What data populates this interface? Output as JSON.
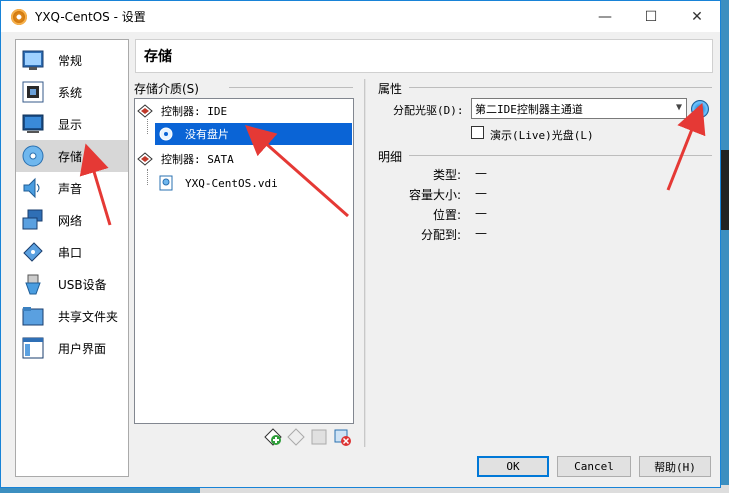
{
  "window": {
    "title": "YXQ-CentOS - 设置",
    "minimize": "—",
    "maximize": "☐",
    "close": "✕"
  },
  "sidebar": {
    "items": [
      {
        "label": "常规",
        "icon": "general-icon"
      },
      {
        "label": "系统",
        "icon": "system-chip-icon"
      },
      {
        "label": "显示",
        "icon": "display-monitor-icon"
      },
      {
        "label": "存储",
        "icon": "storage-disk-icon",
        "active": true
      },
      {
        "label": "声音",
        "icon": "speaker-icon"
      },
      {
        "label": "网络",
        "icon": "network-icon"
      },
      {
        "label": "串口",
        "icon": "serial-port-icon"
      },
      {
        "label": "USB设备",
        "icon": "usb-icon"
      },
      {
        "label": "共享文件夹",
        "icon": "folder-icon"
      },
      {
        "label": "用户界面",
        "icon": "user-interface-icon"
      }
    ]
  },
  "header": {
    "title": "存储"
  },
  "storage": {
    "group_title": "存储介质(S)",
    "tree": [
      {
        "label": "控制器: IDE",
        "type": "controller"
      },
      {
        "label": "没有盘片",
        "type": "optical",
        "selected": true
      },
      {
        "label": "控制器: SATA",
        "type": "controller"
      },
      {
        "label": "YXQ-CentOS.vdi",
        "type": "disk"
      }
    ]
  },
  "attributes": {
    "group_title": "属性",
    "drive_label": "分配光驱(D):",
    "drive_value": "第二IDE控制器主通道",
    "live_cd_label": "演示(Live)光盘(L)"
  },
  "details": {
    "group_title": "明细",
    "rows": [
      {
        "label": "类型:",
        "value": "—"
      },
      {
        "label": "容量大小:",
        "value": "—"
      },
      {
        "label": "位置:",
        "value": "—"
      },
      {
        "label": "分配到:",
        "value": "—"
      }
    ]
  },
  "buttons": {
    "ok": "OK",
    "cancel": "Cancel",
    "help": "帮助(H)"
  },
  "colors": {
    "selection": "#0a64d6",
    "annotation_arrow": "#e53935",
    "window_border": "#1883d7"
  }
}
